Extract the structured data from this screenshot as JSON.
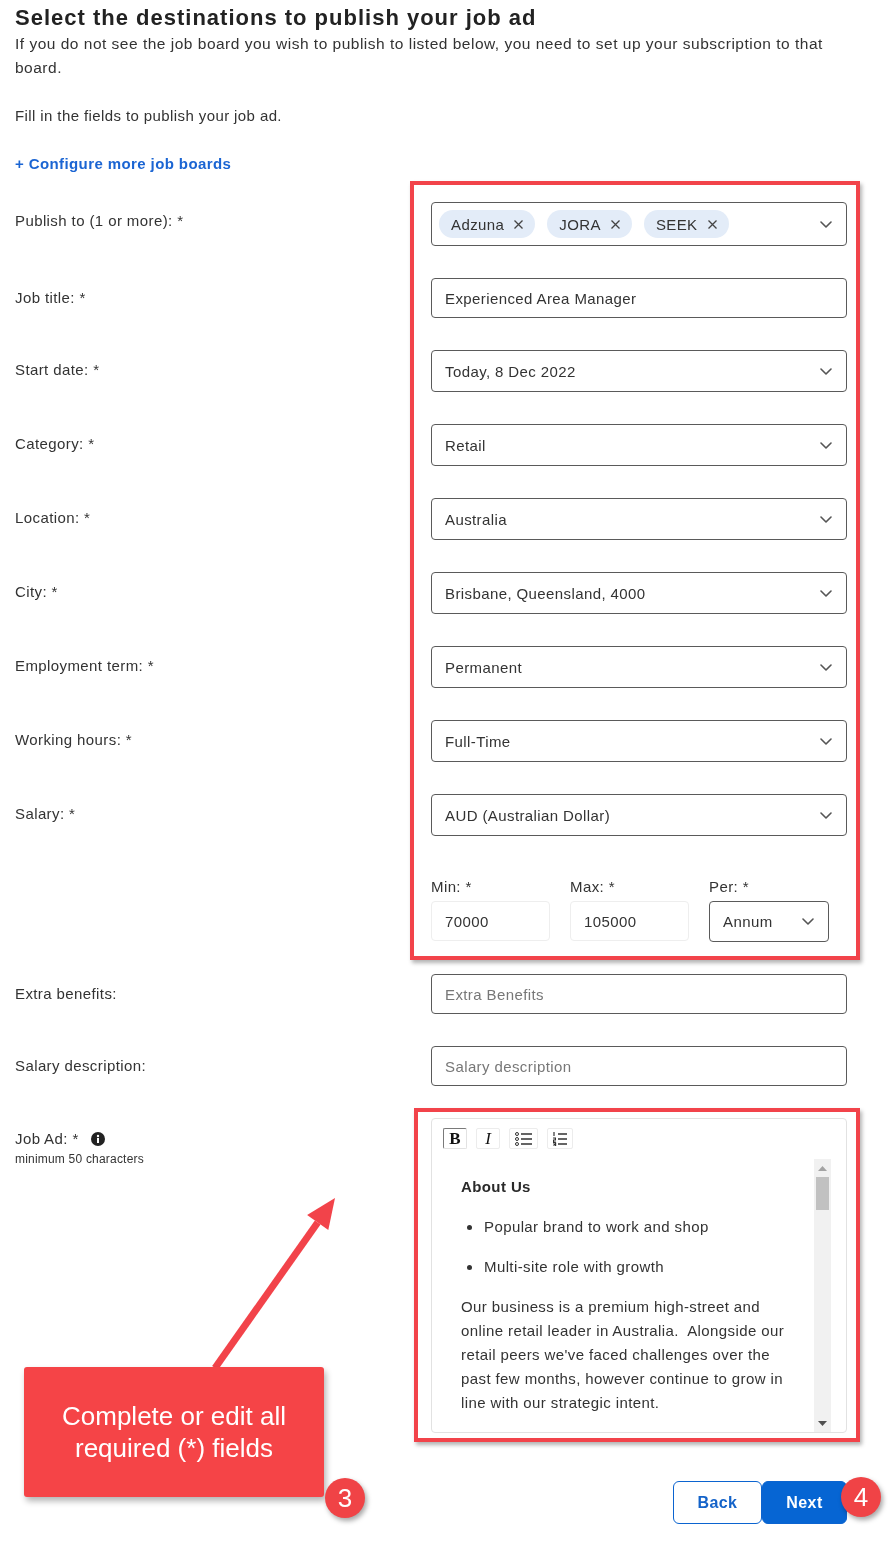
{
  "header": {
    "title": "Select the destinations to publish your job ad",
    "intro": "If you do not see the job board you wish to publish to listed below, you need to set up your subscription to that board.",
    "instruction": "Fill in the fields to publish your job ad.",
    "link": "+ Configure more job boards"
  },
  "form": {
    "fields": [
      {
        "kind": "tags",
        "label": "Publish to (1 or more): *",
        "tags": [
          "Adzuna",
          "JORA",
          "SEEK"
        ]
      },
      {
        "kind": "text",
        "label": "Job title: *",
        "value": "Experienced Area Manager"
      },
      {
        "kind": "select",
        "label": "Start date: *",
        "value": "Today, 8 Dec 2022"
      },
      {
        "kind": "select",
        "label": "Category: *",
        "value": "Retail"
      },
      {
        "kind": "select",
        "label": "Location: *",
        "value": "Australia"
      },
      {
        "kind": "select",
        "label": "City: *",
        "value": "Brisbane, Queensland, 4000"
      },
      {
        "kind": "select",
        "label": "Employment term: *",
        "value": "Permanent"
      },
      {
        "kind": "select",
        "label": "Working hours: *",
        "value": "Full-Time"
      },
      {
        "kind": "select",
        "label": "Salary: *",
        "value": "AUD (Australian Dollar)"
      },
      {
        "kind": "range",
        "parts": [
          {
            "kind": "text",
            "label": "Min: *",
            "value": "70000"
          },
          {
            "kind": "text",
            "label": "Max: *",
            "value": "105000"
          },
          {
            "kind": "select",
            "label": "Per: *",
            "value": "Annum"
          }
        ]
      },
      {
        "kind": "text",
        "label": "Extra benefits:",
        "placeholder": "Extra Benefits"
      },
      {
        "kind": "text",
        "label": "Salary description:",
        "placeholder": "Salary description"
      },
      {
        "kind": "editor",
        "label": "Job Ad: *",
        "hint": "minimum 50 characters",
        "toolbar": [
          {
            "kind": "bold",
            "label": "B",
            "pressed": true
          },
          {
            "kind": "italic",
            "label": "I",
            "pressed": false
          },
          {
            "kind": "bullet_list",
            "pressed": false
          },
          {
            "kind": "numbered_list",
            "pressed": false
          }
        ],
        "content": [
          {
            "kind": "heading",
            "text": "About Us"
          },
          {
            "kind": "bullet",
            "text": "Popular brand to work and shop"
          },
          {
            "kind": "bullet",
            "text": "Multi-site role with growth"
          },
          {
            "kind": "paragraph",
            "text": "Our business is a premium high-street and online retail leader in Australia.  Alongside our retail peers we've faced challenges over the past few months, however continue to grow in line with our strategic intent."
          }
        ]
      }
    ]
  },
  "actions": [
    {
      "kind": "secondary",
      "label": "Back"
    },
    {
      "kind": "primary",
      "label": "Next"
    }
  ],
  "annotations": [
    {
      "kind": "callout",
      "text": "Complete or edit all required (*) fields",
      "step": "3"
    },
    {
      "kind": "step",
      "step": "4"
    }
  ]
}
